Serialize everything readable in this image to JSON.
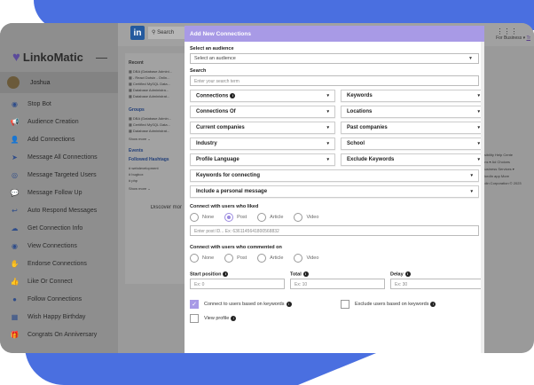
{
  "app": {
    "logo_text": "LinkoMatic",
    "user_name": "Joshua",
    "collapse": "—"
  },
  "sidebar": {
    "items": [
      {
        "label": "Stop Bot",
        "icon": "stop-icon"
      },
      {
        "label": "Audience Creation",
        "icon": "megaphone-icon"
      },
      {
        "label": "Add Connections",
        "icon": "add-user-icon"
      },
      {
        "label": "Message All Connections",
        "icon": "send-icon"
      },
      {
        "label": "Message Targeted Users",
        "icon": "target-icon"
      },
      {
        "label": "Message Follow Up",
        "icon": "chat-icon"
      },
      {
        "label": "Auto Respond Messages",
        "icon": "reply-icon"
      },
      {
        "label": "Get Connection Info",
        "icon": "cloud-download-icon"
      },
      {
        "label": "View Connections",
        "icon": "eye-icon"
      },
      {
        "label": "Endorse Connections",
        "icon": "handshake-icon"
      },
      {
        "label": "Like Or Connect",
        "icon": "thumbs-up-icon"
      },
      {
        "label": "Follow Connections",
        "icon": "follow-icon"
      },
      {
        "label": "Wish Happy Birthday",
        "icon": "birthday-icon"
      },
      {
        "label": "Congrats On Anniversary",
        "icon": "gift-icon"
      }
    ]
  },
  "linkedin": {
    "logo": "in",
    "search": "Search",
    "for_business": "For Business",
    "try": "Tr",
    "feed": {
      "recent_title": "Recent",
      "recent": [
        "DBA (Database Admini...",
        "- React Dotsin - Onlin...",
        "Certified MySQL Data...",
        "Database Administra...",
        "Database Administrat..."
      ],
      "groups_title": "Groups",
      "groups": [
        "DBA (Database Admin...",
        "Certified MySQL Data...",
        "Database Administrat..."
      ],
      "show_more": "Show more",
      "events_title": "Events",
      "hashtag_title": "Followed Hashtags",
      "hashtags": [
        "webdevelopment",
        "bugbox",
        "php"
      ],
      "discover_more": "Discover mor"
    },
    "right": [
      "ssibility   Help Cente",
      "ons ▾   Ad Choices",
      "   Business Services ▾",
      "nkedIn app   More",
      "edin Corporation © 2023"
    ]
  },
  "modal": {
    "title": "Add New Connections",
    "audience_label": "Select an audience",
    "audience_value": "Select an audience",
    "search_label": "Search",
    "search_placeholder": "Enter your search term",
    "filters": [
      {
        "label": "Connections",
        "info": true
      },
      {
        "label": "Keywords"
      },
      {
        "label": "Connections Of"
      },
      {
        "label": "Locations"
      },
      {
        "label": "Current companies"
      },
      {
        "label": "Past companies"
      },
      {
        "label": "Industry"
      },
      {
        "label": "School"
      },
      {
        "label": "Profile Language"
      },
      {
        "label": "Exclude Keywords"
      }
    ],
    "keywords_for_connecting": "Keywords for connecting",
    "personal_message": "Include a personal message",
    "liked_label": "Connect with users who liked",
    "liked_options": [
      "None",
      "Post",
      "Article",
      "Video"
    ],
    "liked_selected": "Post",
    "post_placeholder": "Enter post ID... Ex: 6361145641800568832",
    "commented_label": "Connect with users who commented on",
    "commented_options": [
      "None",
      "Post",
      "Article",
      "Video"
    ],
    "start_label": "Start position",
    "start_placeholder": "Ex: 0",
    "total_label": "Total",
    "total_placeholder": "Ex: 10",
    "delay_label": "Delay",
    "delay_placeholder": "Ex: 30",
    "connect_by_keywords": "Connect to users based on keywords",
    "exclude_by_keywords": "Exclude users based on keywords",
    "view_profile": "View profile"
  },
  "colors": {
    "accent": "#a89ae6",
    "brand_blue": "#4a6fe0",
    "linkedin_blue": "#245a9e"
  }
}
